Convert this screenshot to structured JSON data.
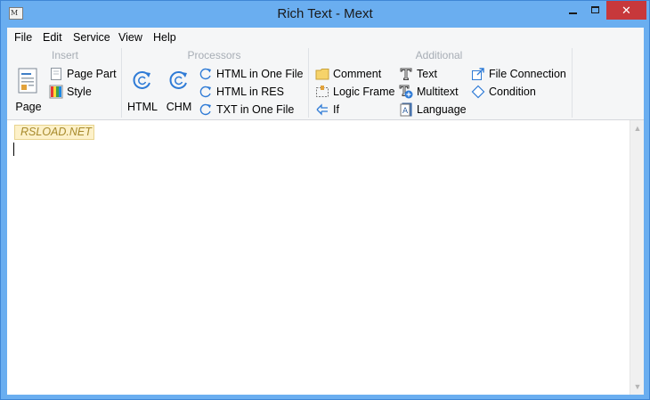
{
  "window": {
    "title": "Rich Text - Mext",
    "app_icon_glyph": "M",
    "controls": {
      "minimize": "minimize-icon",
      "maximize": "maximize-icon",
      "close": "✕"
    }
  },
  "menu": [
    "File",
    "Edit",
    "Service",
    "View",
    "Help"
  ],
  "ribbon": {
    "insert": {
      "label": "Insert",
      "page": "Page",
      "page_part": "Page Part",
      "style": "Style"
    },
    "processors": {
      "label": "Processors",
      "html": "HTML",
      "chm": "CHM",
      "html_one_file": "HTML in One File",
      "html_res": "HTML in RES",
      "txt_one_file": "TXT in One File"
    },
    "additional": {
      "label": "Additional",
      "comment": "Comment",
      "logic_frame": "Logic Frame",
      "if": "If",
      "text": "Text",
      "multitext": "Multitext",
      "language": "Language",
      "file_connection": "File Connection",
      "condition": "Condition"
    }
  },
  "editor": {
    "watermark": "RSLOAD.NET",
    "scroll_up": "▲",
    "scroll_down": "▼"
  },
  "colors": {
    "titlebar": "#6aaef0",
    "close": "#c7383b",
    "ribbon": "#f5f6f7",
    "group_label": "#a7adb5",
    "refresh_icon": "#2f7bd6"
  }
}
